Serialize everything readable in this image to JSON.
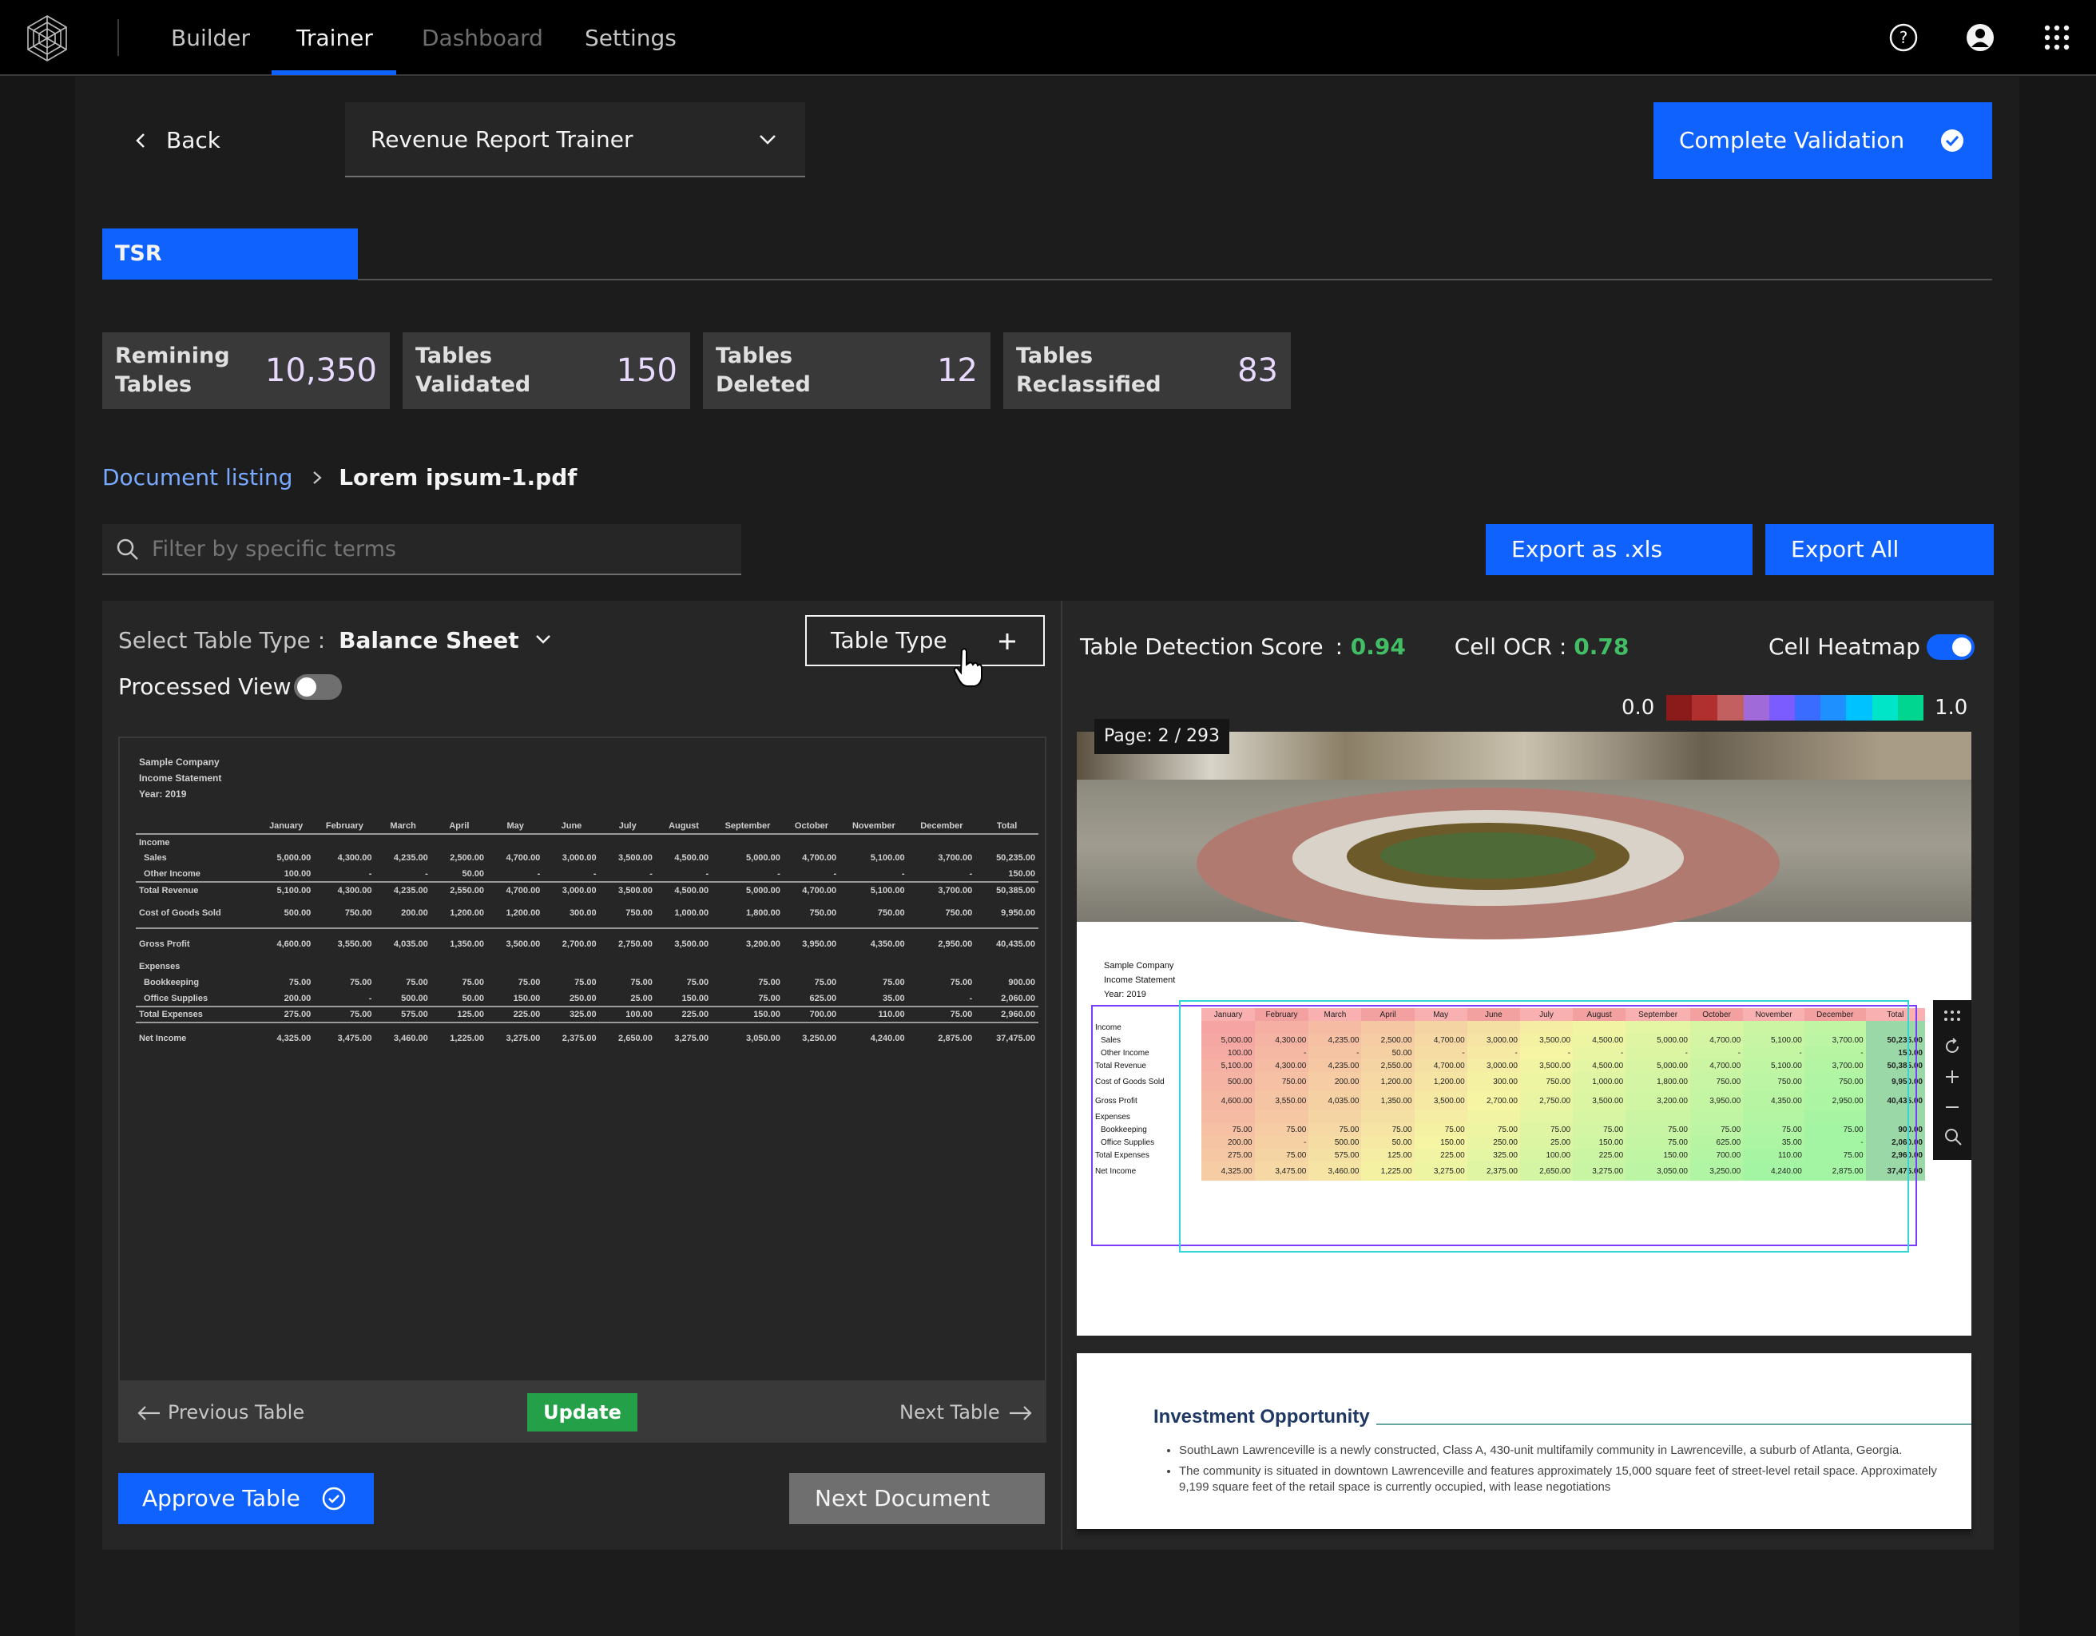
{
  "nav": {
    "items": [
      {
        "label": "Builder"
      },
      {
        "label": "Trainer"
      },
      {
        "label": "Dashboard"
      },
      {
        "label": "Settings"
      }
    ],
    "active": "Trainer"
  },
  "header": {
    "back_label": "Back",
    "trainer_select": "Revenue Report Trainer",
    "complete_label": "Complete Validation"
  },
  "tabs": [
    {
      "label": "TSR"
    }
  ],
  "stats": [
    {
      "label": "Remining\nTables",
      "value": "10,350"
    },
    {
      "label": "Tables\nValidated",
      "value": "150"
    },
    {
      "label": "Tables\nDeleted",
      "value": "12"
    },
    {
      "label": "Tables\nReclassified",
      "value": "83"
    }
  ],
  "breadcrumb": {
    "parent": "Document listing",
    "current": "Lorem ipsum-1.pdf"
  },
  "search": {
    "placeholder": "Filter by specific terms"
  },
  "export": {
    "xls_label": "Export as .xls",
    "all_label": "Export All"
  },
  "left_panel": {
    "select_label": "Select Table Type :",
    "select_value": "Balance Sheet",
    "table_type_button": "Table Type",
    "processed_view_label": "Processed View",
    "processed_view_on": false,
    "prev_label": "Previous Table",
    "update_label": "Update",
    "next_label": "Next Table",
    "approve_label": "Approve Table",
    "next_document_label": "Next Document"
  },
  "right_panel": {
    "detection_label": "Table Detection Score",
    "detection_value": ": 0.94",
    "ocr_label": "Cell OCR :",
    "ocr_value": "0.78",
    "heatmap_label": "Cell Heatmap",
    "heatmap_on": true,
    "scale_min": "0.0",
    "scale_max": "1.0",
    "page_label": "Page: 2 / 293",
    "scale_colors": [
      "#8b1a1a",
      "#b03030",
      "#c26060",
      "#a06ad8",
      "#7a5cff",
      "#3a6cff",
      "#1e90ff",
      "#00c2ff",
      "#00e5c8",
      "#00d68f"
    ],
    "investment_title": "Investment Opportunity",
    "investment_bullets": [
      "SouthLawn Lawrenceville is a newly constructed, Class A, 430-unit multifamily community in Lawrenceville, a suburb of Atlanta, Georgia.",
      "The community is situated in downtown Lawrenceville and features approximately 15,000 square feet of street-level retail space. Approximately 9,199 square feet of the retail space is currently occupied, with lease negotiations"
    ]
  },
  "document": {
    "company": "Sample Company",
    "statement": "Income Statement",
    "year": "Year:  2019",
    "columns": [
      "January",
      "February",
      "March",
      "April",
      "May",
      "June",
      "July",
      "August",
      "September",
      "October",
      "November",
      "December",
      "Total"
    ],
    "rows": [
      {
        "label": "Income",
        "values": []
      },
      {
        "label": "Sales",
        "values": [
          "5,000.00",
          "4,300.00",
          "4,235.00",
          "2,500.00",
          "4,700.00",
          "3,000.00",
          "3,500.00",
          "4,500.00",
          "5,000.00",
          "4,700.00",
          "5,100.00",
          "3,700.00",
          "50,235.00"
        ]
      },
      {
        "label": "Other Income",
        "values": [
          "100.00",
          "-",
          "-",
          "50.00",
          "-",
          "-",
          "-",
          "-",
          "-",
          "-",
          "-",
          "-",
          "150.00"
        ]
      },
      {
        "label": "Total Revenue",
        "values": [
          "5,100.00",
          "4,300.00",
          "4,235.00",
          "2,550.00",
          "4,700.00",
          "3,000.00",
          "3,500.00",
          "4,500.00",
          "5,000.00",
          "4,700.00",
          "5,100.00",
          "3,700.00",
          "50,385.00"
        ]
      },
      {
        "label": "Cost of Goods Sold",
        "values": [
          "500.00",
          "750.00",
          "200.00",
          "1,200.00",
          "1,200.00",
          "300.00",
          "750.00",
          "1,000.00",
          "1,800.00",
          "750.00",
          "750.00",
          "750.00",
          "9,950.00"
        ]
      },
      {
        "label": "Gross Profit",
        "values": [
          "4,600.00",
          "3,550.00",
          "4,035.00",
          "1,350.00",
          "3,500.00",
          "2,700.00",
          "2,750.00",
          "3,500.00",
          "3,200.00",
          "3,950.00",
          "4,350.00",
          "2,950.00",
          "40,435.00"
        ]
      },
      {
        "label": "Expenses",
        "values": []
      },
      {
        "label": "Bookkeeping",
        "values": [
          "75.00",
          "75.00",
          "75.00",
          "75.00",
          "75.00",
          "75.00",
          "75.00",
          "75.00",
          "75.00",
          "75.00",
          "75.00",
          "75.00",
          "900.00"
        ]
      },
      {
        "label": "Office Supplies",
        "values": [
          "200.00",
          "-",
          "500.00",
          "50.00",
          "150.00",
          "250.00",
          "25.00",
          "150.00",
          "75.00",
          "625.00",
          "35.00",
          "-",
          "2,060.00"
        ]
      },
      {
        "label": "Total Expenses",
        "values": [
          "275.00",
          "75.00",
          "575.00",
          "125.00",
          "225.00",
          "325.00",
          "100.00",
          "225.00",
          "150.00",
          "700.00",
          "110.00",
          "75.00",
          "2,960.00"
        ]
      },
      {
        "label": "Net Income",
        "values": [
          "4,325.00",
          "3,475.00",
          "3,460.00",
          "1,225.00",
          "3,275.00",
          "2,375.00",
          "2,650.00",
          "3,275.00",
          "3,050.00",
          "3,250.00",
          "4,240.00",
          "2,875.00",
          "37,475.00"
        ]
      }
    ]
  },
  "colors": {
    "accent": "#0f62fe",
    "score_green": "#42be65",
    "update_green": "#24a148"
  }
}
